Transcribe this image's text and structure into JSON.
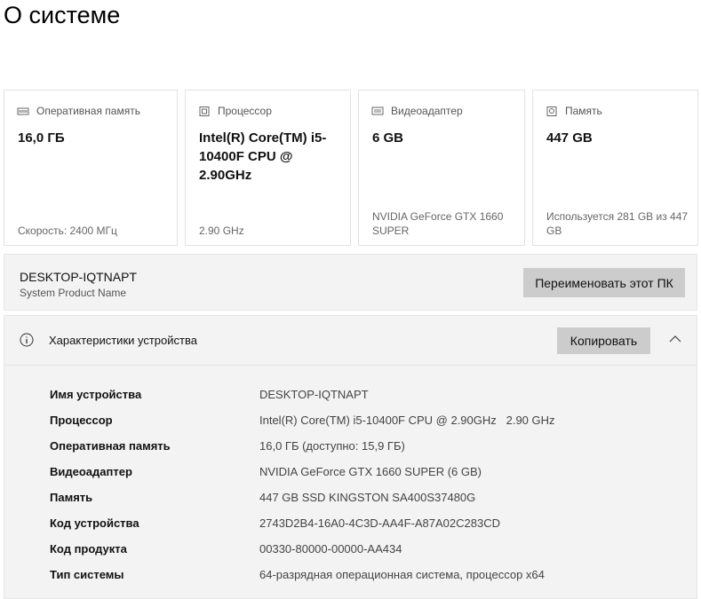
{
  "title": "О системе",
  "cards": [
    {
      "icon": "memory-icon",
      "label": "Оперативная память",
      "value": "16,0 ГБ",
      "footer": "Скорость: 2400 МГц"
    },
    {
      "icon": "processor-icon",
      "label": "Процессор",
      "value": "Intel(R) Core(TM) i5-10400F CPU @ 2.90GHz",
      "footer": "2.90 GHz"
    },
    {
      "icon": "display-adapter-icon",
      "label": "Видеоадаптер",
      "value": "6 GB",
      "footer": "NVIDIA GeForce GTX 1660 SUPER"
    },
    {
      "icon": "storage-icon",
      "label": "Память",
      "value": "447 GB",
      "footer": "Используется 281 GB из 447 GB"
    }
  ],
  "pc": {
    "name": "DESKTOP-IQTNAPT",
    "subtitle": "System Product Name",
    "rename_label": "Переименовать этот ПК"
  },
  "specs": {
    "header": "Характеристики устройства",
    "copy_label": "Копировать",
    "rows": [
      {
        "k": "Имя устройства",
        "v": "DESKTOP-IQTNAPT"
      },
      {
        "k": "Процессор",
        "v": "Intel(R) Core(TM) i5-10400F CPU @ 2.90GHz   2.90 GHz"
      },
      {
        "k": "Оперативная память",
        "v": "16,0 ГБ (доступно: 15,9 ГБ)"
      },
      {
        "k": "Видеоадаптер",
        "v": "NVIDIA GeForce GTX 1660 SUPER (6 GB)"
      },
      {
        "k": "Память",
        "v": "447 GB SSD KINGSTON SA400S37480G"
      },
      {
        "k": "Код устройства",
        "v": "2743D2B4-16A0-4C3D-AA4F-A87A02C283CD"
      },
      {
        "k": "Код продукта",
        "v": "00330-80000-00000-AA434"
      },
      {
        "k": "Тип системы",
        "v": "64-разрядная операционная система, процессор x64"
      }
    ]
  }
}
